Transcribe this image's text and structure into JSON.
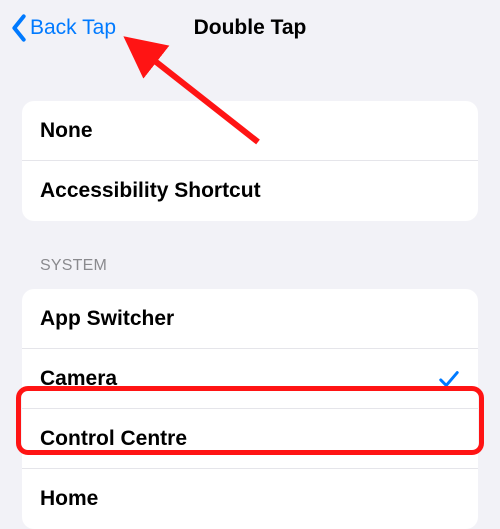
{
  "nav": {
    "back_label": "Back Tap",
    "title": "Double Tap"
  },
  "group1": {
    "items": [
      {
        "label": "None",
        "selected": false
      },
      {
        "label": "Accessibility Shortcut",
        "selected": false
      }
    ]
  },
  "section_header": "System",
  "group2": {
    "items": [
      {
        "label": "App Switcher",
        "selected": false
      },
      {
        "label": "Camera",
        "selected": true
      },
      {
        "label": "Control Centre",
        "selected": false
      },
      {
        "label": "Home",
        "selected": false
      }
    ]
  },
  "colors": {
    "accent": "#007aff",
    "annotation": "#ff1414"
  }
}
